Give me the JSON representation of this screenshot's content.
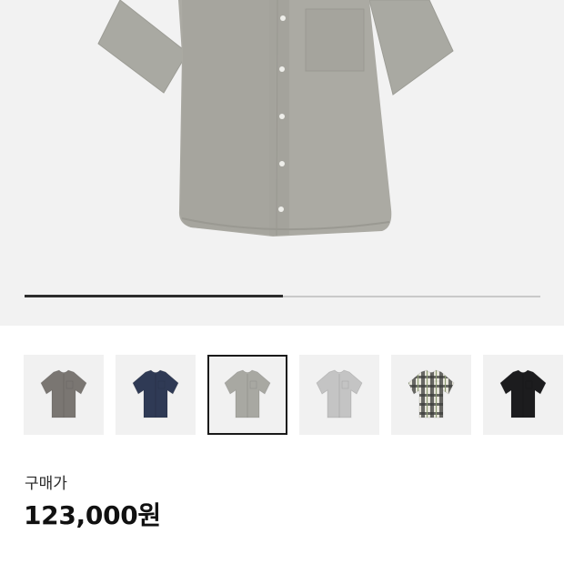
{
  "product": {
    "main_image": "shirt-photo-gray-short-sleeve",
    "gallery_progress": 0.5
  },
  "thumbnails": [
    {
      "name": "thumb-charcoal-shirt",
      "icon": "shirt-charcoal",
      "color": "#7a7672",
      "selected": false
    },
    {
      "name": "thumb-navy-shirt",
      "icon": "shirt-navy",
      "color": "#2f3a55",
      "selected": false
    },
    {
      "name": "thumb-gray-shirt",
      "icon": "shirt-gray",
      "color": "#a8a8a2",
      "selected": true
    },
    {
      "name": "thumb-light-gray-shirt",
      "icon": "shirt-light-gray",
      "color": "#c4c4c4",
      "selected": false
    },
    {
      "name": "thumb-plaid-shirt",
      "icon": "shirt-plaid",
      "color": "#e3e2d6",
      "selected": false
    },
    {
      "name": "thumb-black-shirt",
      "icon": "shirt-black",
      "color": "#1c1c1e",
      "selected": false
    }
  ],
  "price": {
    "label": "구매가",
    "value": "123,000원"
  },
  "colors": {
    "hero_bg": "#f2f2f2",
    "shirt_main": "#aaaaa3",
    "progress_fill": "#2d2d2d",
    "progress_track": "#c9c9c9"
  }
}
